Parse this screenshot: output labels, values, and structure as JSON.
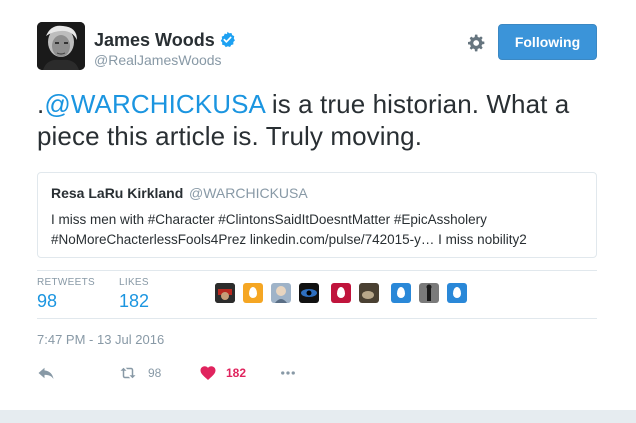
{
  "author": {
    "name": "James Woods",
    "handle": "@RealJamesWoods",
    "verified": true
  },
  "follow_button": {
    "label": "Following"
  },
  "tweet": {
    "prefix": ".",
    "mention": "@WARCHICKUSA",
    "text": " is a true historian. What a piece this article is. Truly moving."
  },
  "quoted_tweet": {
    "name": "Resa LaRu Kirkland",
    "handle": "@WARCHICKUSA",
    "text": "I miss men with #Character #ClintonsSaidItDoesntMatter #EpicAssholery #NoMoreChacterlessFools4Prez linkedin.com/pulse/742015-y… I miss nobility2"
  },
  "stats": {
    "retweets_label": "RETWEETS",
    "retweets_value": "98",
    "likes_label": "LIKES",
    "likes_value": "182"
  },
  "timestamp": "7:47 PM - 13 Jul 2016",
  "actions": {
    "retweet_count": "98",
    "like_count": "182"
  },
  "colors": {
    "link": "#1b95e0",
    "button": "#3b94d9",
    "like": "#e0245e",
    "muted": "#8899a6"
  },
  "icons": [
    "verified-badge-icon",
    "gear-icon",
    "reply-icon",
    "retweet-icon",
    "heart-icon",
    "more-icon"
  ]
}
